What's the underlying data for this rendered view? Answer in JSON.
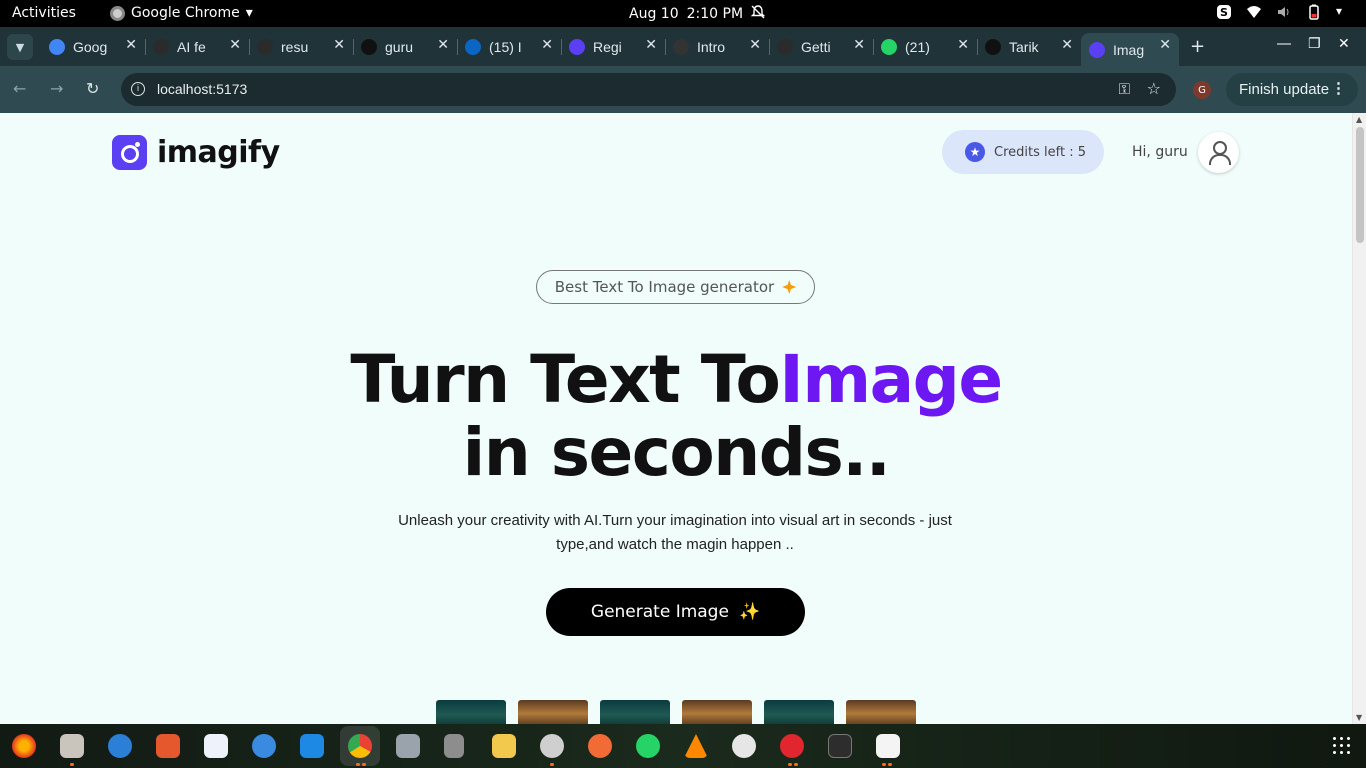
{
  "system": {
    "activities": "Activities",
    "app_name": "Google Chrome",
    "date": "Aug 10",
    "time": "2:10 PM"
  },
  "tabs": [
    {
      "title": "Goog",
      "favicon": "gemini-icon",
      "color": "#4285f4"
    },
    {
      "title": "AI fe",
      "favicon": "chatgpt-icon",
      "color": "#2b2b2b"
    },
    {
      "title": "resu",
      "favicon": "chatgpt-icon",
      "color": "#2b2b2b"
    },
    {
      "title": "guru",
      "favicon": "github-icon",
      "color": "#111111"
    },
    {
      "title": "(15) I",
      "favicon": "linkedin-icon",
      "color": "#0a66c2"
    },
    {
      "title": "Regi",
      "favicon": "q-icon",
      "color": "#5b3ff2"
    },
    {
      "title": "Intro",
      "favicon": "course-icon",
      "color": "#333333"
    },
    {
      "title": "Getti",
      "favicon": "openai-icon",
      "color": "#2b2b2b"
    },
    {
      "title": "(21)",
      "favicon": "whatsapp-icon",
      "color": "#25d366"
    },
    {
      "title": "Tarik",
      "favicon": "github-icon",
      "color": "#111111"
    },
    {
      "title": "Imag",
      "favicon": "imagify-icon",
      "color": "#5b3ff2",
      "active": true
    }
  ],
  "toolbar": {
    "url": "localhost:5173",
    "profile_initial": "G",
    "finish_update": "Finish update"
  },
  "page": {
    "logo_text": "imagify",
    "credits": "Credits left : 5",
    "greeting": "Hi, guru",
    "badge": "Best Text To Image generator",
    "headline_part1": "Turn Text To",
    "headline_accent": "Image",
    "headline_line2": "in seconds..",
    "subtitle": "Unleash your creativity with AI.Turn your imagination into visual art in seconds - just type,and watch the magin happen ..",
    "cta": "Generate Image",
    "cta_emoji": "✨",
    "accent_color": "#6d17f3",
    "background": "#f0fdfa"
  }
}
